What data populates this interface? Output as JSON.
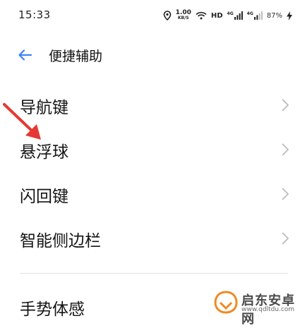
{
  "status_bar": {
    "time": "15:33",
    "net_speed_value": "1.00",
    "net_speed_unit": "KB/S",
    "hd_label": "HD",
    "signal1_tag": "4G",
    "signal2_tag": "4G",
    "battery_percent": "87%",
    "icons": [
      "location-icon",
      "wifi-icon",
      "signal-icon",
      "signal-icon",
      "charging-icon"
    ]
  },
  "header": {
    "title": "便捷辅助",
    "back_icon": "back-arrow-icon"
  },
  "menu": {
    "items": [
      {
        "label": "导航键"
      },
      {
        "label": "悬浮球"
      },
      {
        "label": "闪回键"
      },
      {
        "label": "智能侧边栏"
      },
      {
        "label": "手势体感"
      }
    ]
  },
  "annotation": {
    "arrow_color": "#e53935"
  },
  "watermark": {
    "name": "启东安卓网",
    "url": "www.qdltdu.com"
  },
  "colors": {
    "accent": "#3b82f6",
    "chevron": "#b8b8b8",
    "divider": "#e2e2e2",
    "watermark_orange": "#f08a24"
  }
}
